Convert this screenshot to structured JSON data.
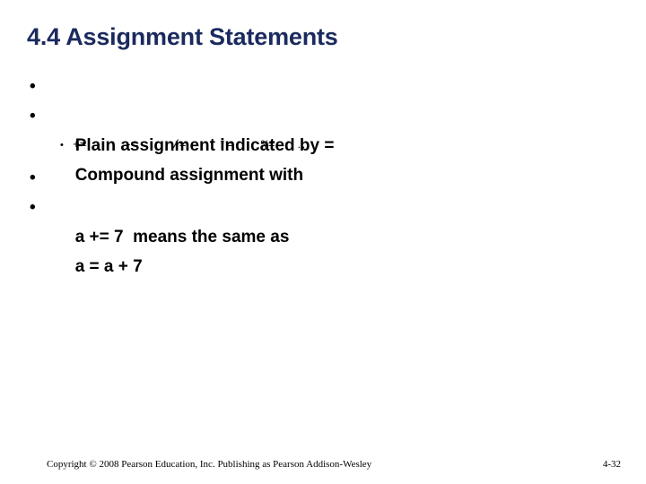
{
  "slide": {
    "title": "4.4 Assignment Statements",
    "title_color": "#1b2a5e",
    "background_color": "#ffffff",
    "body_text_color": "#000000",
    "bullet_glyph": "•",
    "sub_bullet_glyph": "•",
    "bullets": [
      {
        "level": 1,
        "text": "Plain assignment indicated by ="
      },
      {
        "level": 1,
        "text": "Compound assignment with"
      }
    ],
    "operators_row": {
      "level": 2,
      "items": [
        "+=",
        "-=",
        "/=",
        "*=",
        "%=",
        "…"
      ]
    },
    "bullets_after": [
      {
        "level": 1,
        "text": "a += 7  means the same as"
      },
      {
        "level": 1,
        "text": "a = a + 7"
      }
    ]
  },
  "footer": {
    "copyright": "Copyright © 2008 Pearson Education, Inc. Publishing as Pearson Addison-Wesley",
    "page_number": "4-32"
  }
}
